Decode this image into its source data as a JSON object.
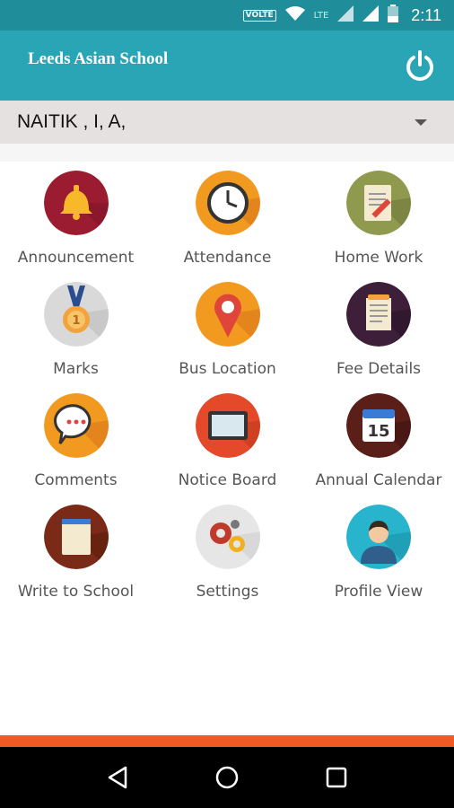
{
  "status_bar": {
    "volte": "VOLTE",
    "network": "LTE",
    "time": "2:11"
  },
  "app_bar": {
    "title": "Leeds Asian School",
    "power_icon": "power-icon"
  },
  "student_selector": {
    "value": "NAITIK , I, A,"
  },
  "menu": [
    {
      "label": "Announcement",
      "icon": "bell-icon"
    },
    {
      "label": "Attendance",
      "icon": "clock-icon"
    },
    {
      "label": "Home Work",
      "icon": "notepad-pencil-icon"
    },
    {
      "label": "Marks",
      "icon": "medal-icon"
    },
    {
      "label": "Bus Location",
      "icon": "location-pin-icon"
    },
    {
      "label": "Fee Details",
      "icon": "receipt-icon"
    },
    {
      "label": "Comments",
      "icon": "chat-bubble-icon"
    },
    {
      "label": "Notice Board",
      "icon": "board-icon"
    },
    {
      "label": "Annual Calendar",
      "icon": "calendar-icon",
      "calendar_day": "15"
    },
    {
      "label": "Write to School",
      "icon": "note-icon"
    },
    {
      "label": "Settings",
      "icon": "gears-icon"
    },
    {
      "label": "Profile View",
      "icon": "user-icon"
    }
  ],
  "colors": {
    "status_bar": "#1f8d9a",
    "app_bar": "#2aa5b5",
    "accent_bar": "#f05a24"
  },
  "nav": {
    "back": "back-icon",
    "home": "home-icon",
    "recents": "recents-icon"
  }
}
